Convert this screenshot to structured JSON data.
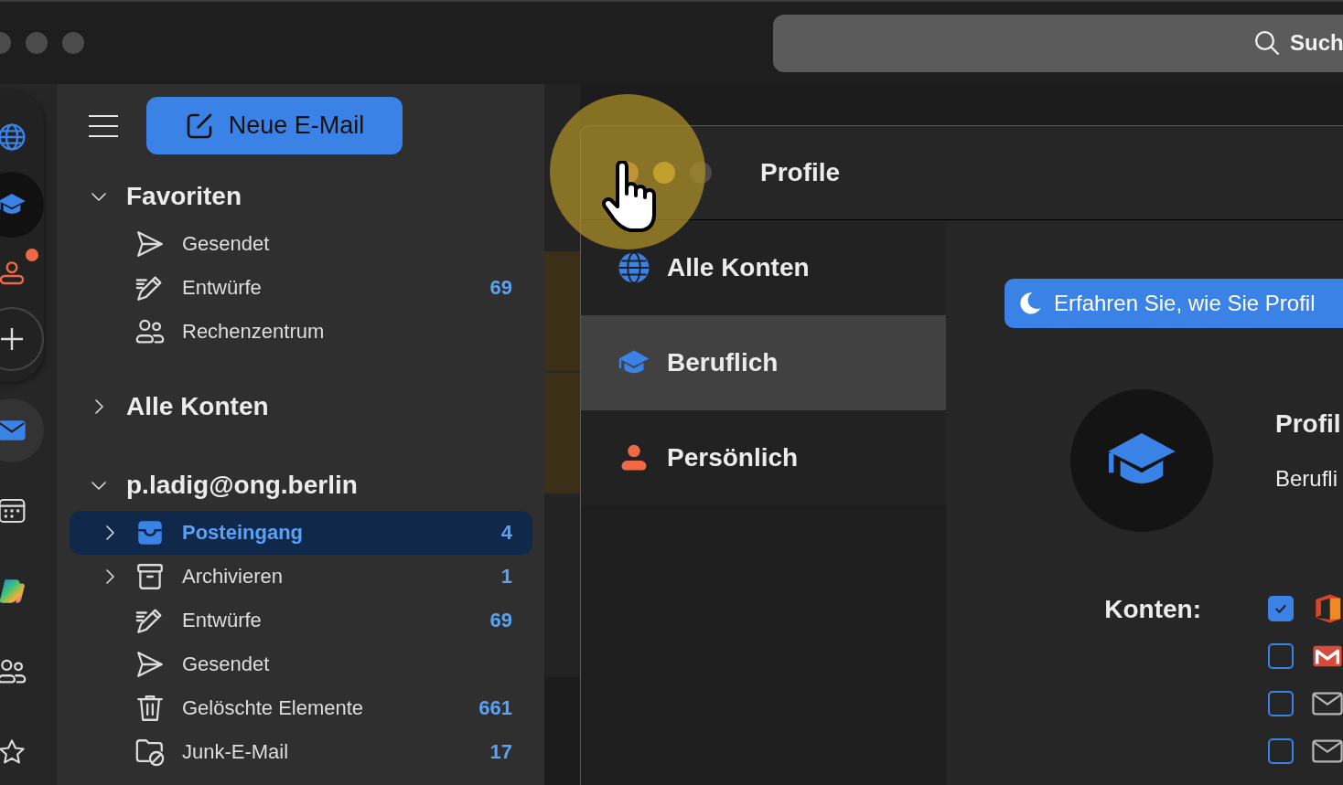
{
  "window": {
    "search": {
      "placeholder": "Such"
    }
  },
  "rail": {
    "profiles": [
      {
        "kind": "globe",
        "selected": false,
        "notification": false
      },
      {
        "kind": "cap",
        "selected": true,
        "notification": false
      },
      {
        "kind": "person",
        "selected": false,
        "notification": true
      },
      {
        "kind": "add",
        "selected": false,
        "notification": false
      }
    ],
    "apps": [
      {
        "kind": "mail",
        "selected": true
      },
      {
        "kind": "calendar",
        "selected": false
      },
      {
        "kind": "copilot",
        "selected": false
      },
      {
        "kind": "people",
        "selected": false
      },
      {
        "kind": "star",
        "selected": false
      }
    ]
  },
  "sidebar": {
    "new_mail_button": "Neue E-Mail",
    "sections": [
      {
        "title": "Favoriten",
        "expanded": true,
        "items": [
          {
            "kind": "sent",
            "label": "Gesendet",
            "selected": false,
            "expandable": false
          },
          {
            "kind": "drafts",
            "label": "Entwürfe",
            "count": "69",
            "selected": false,
            "expandable": false
          },
          {
            "kind": "group",
            "label": "Rechenzentrum",
            "selected": false,
            "expandable": false
          }
        ]
      },
      {
        "title": "Alle Konten",
        "expanded": false
      },
      {
        "title": "p.ladig@ong.berlin",
        "expanded": true,
        "items": [
          {
            "kind": "inbox",
            "label": "Posteingang",
            "count": "4",
            "selected": true,
            "expandable": true
          },
          {
            "kind": "archive",
            "label": "Archivieren",
            "count": "1",
            "selected": false,
            "expandable": true
          },
          {
            "kind": "drafts",
            "label": "Entwürfe",
            "count": "69",
            "selected": false,
            "expandable": false
          },
          {
            "kind": "sent",
            "label": "Gesendet",
            "selected": false,
            "expandable": false
          },
          {
            "kind": "trash",
            "label": "Gelöschte Elemente",
            "count": "661",
            "selected": false,
            "expandable": false
          },
          {
            "kind": "junk",
            "label": "Junk-E-Mail",
            "count": "17",
            "selected": false,
            "expandable": false
          }
        ]
      }
    ]
  },
  "dialog": {
    "title": "Profile",
    "profiles": [
      {
        "kind": "globe",
        "label": "Alle Konten",
        "selected": false
      },
      {
        "kind": "cap",
        "label": "Beruflich",
        "selected": true
      },
      {
        "kind": "person",
        "label": "Persönlich",
        "selected": false
      }
    ],
    "banner": "Erfahren Sie, wie Sie Profil",
    "detail": {
      "name_label": "Profil",
      "name_value": "Berufli",
      "accounts_label": "Konten:",
      "accounts": [
        {
          "kind": "office",
          "checked": true
        },
        {
          "kind": "gmail",
          "checked": false
        },
        {
          "kind": "mail",
          "checked": false
        },
        {
          "kind": "mail",
          "checked": false
        }
      ]
    }
  }
}
